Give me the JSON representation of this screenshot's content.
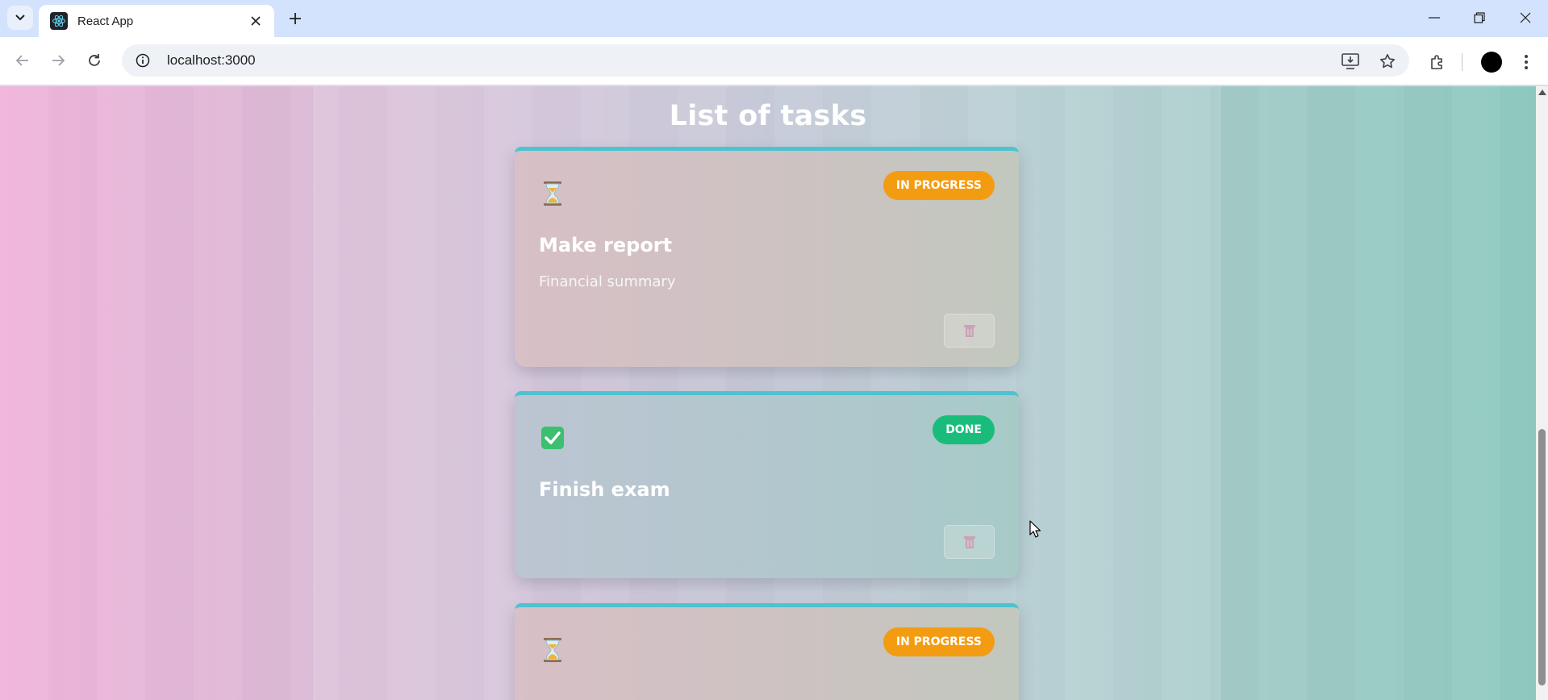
{
  "browser": {
    "tab_title": "React App",
    "url": "localhost:3000"
  },
  "page": {
    "title": "List of tasks"
  },
  "tasks": [
    {
      "status": "IN PROGRESS",
      "icon": "hourglass-icon",
      "title": "Make report",
      "description": "Financial summary"
    },
    {
      "status": "DONE",
      "icon": "check-box-icon",
      "title": "Finish exam",
      "description": ""
    },
    {
      "status": "IN PROGRESS",
      "icon": "hourglass-icon",
      "title": "",
      "description": ""
    }
  ],
  "colors": {
    "accent_border": "#4ec3cf",
    "in_progress": "#f39c12",
    "done": "#1abc7c"
  }
}
